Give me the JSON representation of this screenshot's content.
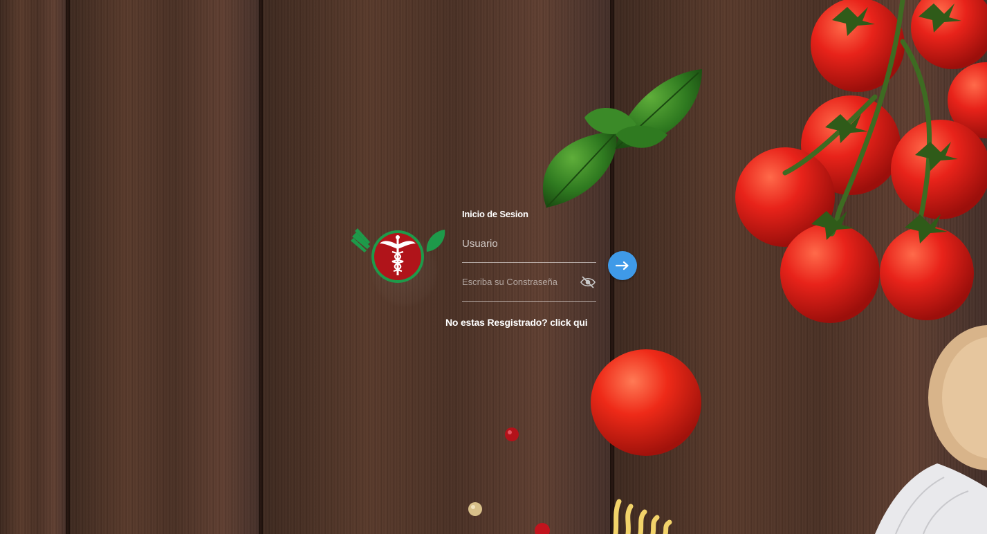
{
  "login": {
    "title": "Inicio de Sesion",
    "username_placeholder": "Usuario",
    "password_placeholder": "Escriba su Constraseña",
    "register_link": "No estas Resgistrado? click qui"
  },
  "icons": {
    "logo": "caduceus-logo-icon",
    "toggle_password": "eye-slash-icon",
    "submit": "arrow-right-icon"
  },
  "colors": {
    "accent": "#3f9ae8",
    "logo_red": "#b0141a",
    "logo_green": "#1e9a4a",
    "text": "#ffffff"
  }
}
